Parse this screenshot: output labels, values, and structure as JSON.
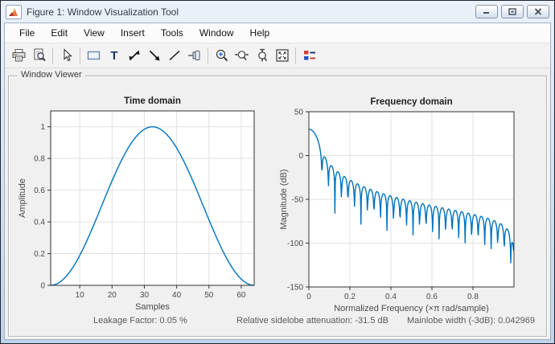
{
  "window": {
    "title": "Figure 1: Window Visualization Tool",
    "app_icon": "matlab-logo",
    "controls": [
      "minimize",
      "restore",
      "close"
    ]
  },
  "menu": {
    "items": [
      "File",
      "Edit",
      "View",
      "Insert",
      "Tools",
      "Window",
      "Help"
    ]
  },
  "toolbar": {
    "buttons": [
      "print",
      "print-preview",
      "pointer",
      "rectangle",
      "text-annotation",
      "double-arrow",
      "single-arrow",
      "line",
      "pin",
      "zoom-in",
      "zoom-x",
      "zoom-y",
      "fit-view",
      "legend"
    ],
    "separators_after": [
      "print-preview",
      "pointer",
      "pin",
      "fit-view"
    ]
  },
  "viewer": {
    "label": "Window Viewer"
  },
  "status": {
    "leakage": "Leakage Factor: 0.05 %",
    "sidelobe_attenuation": "Relative sidelobe attenuation: -31.5 dB",
    "mainlobe_width": "Mainlobe width (-3dB): 0.042969"
  },
  "colors": {
    "line": "#0072BD",
    "grid": "#e0e0e0",
    "axis": "#333333",
    "tick_label": "#4a4a4a",
    "title": "#1f1f1f"
  },
  "chart_data": [
    {
      "id": "chart-time",
      "type": "line",
      "title": "Time domain",
      "xlabel": "Samples",
      "ylabel": "Amplitude",
      "xlim": [
        1,
        64
      ],
      "ylim": [
        0,
        1.1
      ],
      "xticks": [
        10,
        20,
        30,
        40,
        50,
        60
      ],
      "yticks": [
        0,
        0.2,
        0.4,
        0.6,
        0.8,
        1
      ],
      "grid": true,
      "generator": {
        "kind": "hann",
        "N": 64
      },
      "key_points": {
        "start": [
          1,
          0
        ],
        "peak": [
          32.5,
          1
        ],
        "end": [
          64,
          0
        ]
      }
    },
    {
      "id": "chart-freq",
      "type": "line",
      "title": "Frequency domain",
      "xlabel": "Normalized Frequency  (×π rad/sample)",
      "ylabel": "Magnitude (dB)",
      "xlim": [
        0,
        1
      ],
      "ylim": [
        -150,
        50
      ],
      "xticks": [
        0,
        0.2,
        0.4,
        0.6,
        0.8
      ],
      "yticks": [
        50,
        0,
        -50,
        -100,
        -150
      ],
      "grid": true,
      "generator": {
        "kind": "hann_dtft_db",
        "N": 64,
        "nfft": 512
      },
      "key_points": {
        "peak_db": 30,
        "first_null_x": 0.0625,
        "first_sidelobe_db": -1.5,
        "relative_sidelobe_db": -31.5
      }
    }
  ]
}
